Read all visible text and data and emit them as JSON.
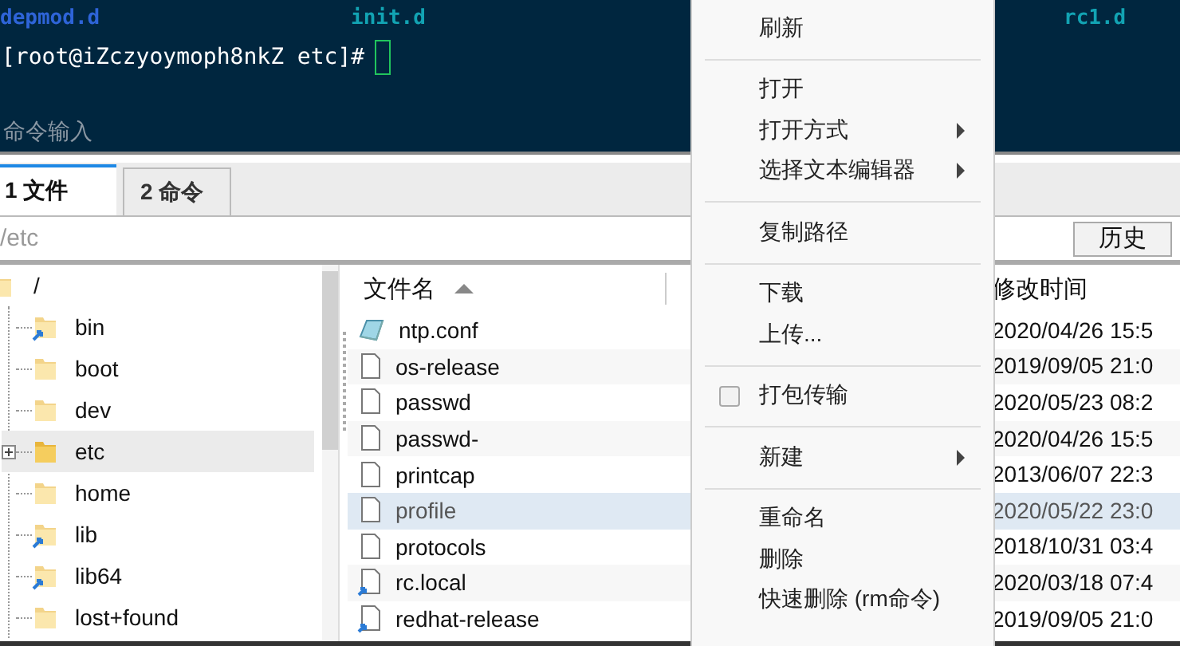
{
  "terminal": {
    "listing": [
      {
        "text": "depmod.d",
        "kind": "dir"
      },
      {
        "text": "init.d",
        "kind": "exec"
      },
      {
        "text": "rc1.d",
        "kind": "exec"
      }
    ],
    "prompt": "[root@iZczyoymoph8nkZ etc]#",
    "input_placeholder": "命令输入"
  },
  "tabs": [
    {
      "label": "1 文件",
      "selected": true
    },
    {
      "label": "2 命令",
      "selected": false
    }
  ],
  "path": "/etc",
  "history_button": "历史",
  "tree": {
    "name": "/",
    "children": [
      {
        "name": "bin",
        "link": true,
        "expandable": false,
        "selected": false
      },
      {
        "name": "boot",
        "link": false,
        "expandable": false,
        "selected": false
      },
      {
        "name": "dev",
        "link": false,
        "expandable": false,
        "selected": false
      },
      {
        "name": "etc",
        "link": false,
        "expandable": true,
        "selected": true
      },
      {
        "name": "home",
        "link": false,
        "expandable": false,
        "selected": false
      },
      {
        "name": "lib",
        "link": true,
        "expandable": false,
        "selected": false
      },
      {
        "name": "lib64",
        "link": true,
        "expandable": false,
        "selected": false
      },
      {
        "name": "lost+found",
        "link": false,
        "expandable": false,
        "selected": false
      }
    ]
  },
  "files": {
    "columns": [
      "文件名",
      "修改时间"
    ],
    "rows": [
      {
        "name": "ntp.conf",
        "modified": "2020/04/26 15:5",
        "kind": "config",
        "link": false,
        "selected": false
      },
      {
        "name": "os-release",
        "modified": "2019/09/05 21:0",
        "kind": "file",
        "link": false,
        "selected": false
      },
      {
        "name": "passwd",
        "modified": "2020/05/23 08:2",
        "kind": "file",
        "link": false,
        "selected": false
      },
      {
        "name": "passwd-",
        "modified": "2020/04/26 15:5",
        "kind": "file",
        "link": false,
        "selected": false
      },
      {
        "name": "printcap",
        "modified": "2013/06/07 22:3",
        "kind": "file",
        "link": false,
        "selected": false
      },
      {
        "name": "profile",
        "modified": "2020/05/22 23:0",
        "kind": "file",
        "link": false,
        "selected": true
      },
      {
        "name": "protocols",
        "modified": "2018/10/31 03:4",
        "kind": "file",
        "link": false,
        "selected": false
      },
      {
        "name": "rc.local",
        "modified": "2020/03/18 07:4",
        "kind": "file",
        "link": true,
        "selected": false
      },
      {
        "name": "redhat-release",
        "modified": "2019/09/05 21:0",
        "kind": "file",
        "link": true,
        "selected": false
      }
    ]
  },
  "menu": [
    {
      "kind": "item",
      "label": "刷新",
      "submenu": false
    },
    {
      "kind": "separator"
    },
    {
      "kind": "item",
      "label": "打开",
      "submenu": false
    },
    {
      "kind": "item",
      "label": "打开方式",
      "submenu": true
    },
    {
      "kind": "item",
      "label": "选择文本编辑器",
      "submenu": true
    },
    {
      "kind": "separator"
    },
    {
      "kind": "item",
      "label": "复制路径",
      "submenu": false
    },
    {
      "kind": "separator"
    },
    {
      "kind": "item",
      "label": "下载",
      "submenu": false
    },
    {
      "kind": "item",
      "label": "上传...",
      "submenu": false
    },
    {
      "kind": "separator"
    },
    {
      "kind": "check",
      "label": "打包传输",
      "checked": false
    },
    {
      "kind": "separator"
    },
    {
      "kind": "item",
      "label": "新建",
      "submenu": true
    },
    {
      "kind": "separator"
    },
    {
      "kind": "item",
      "label": "重命名",
      "submenu": false
    },
    {
      "kind": "item",
      "label": "删除",
      "submenu": false
    },
    {
      "kind": "item",
      "label": "快速删除 (rm命令)",
      "submenu": false
    }
  ]
}
